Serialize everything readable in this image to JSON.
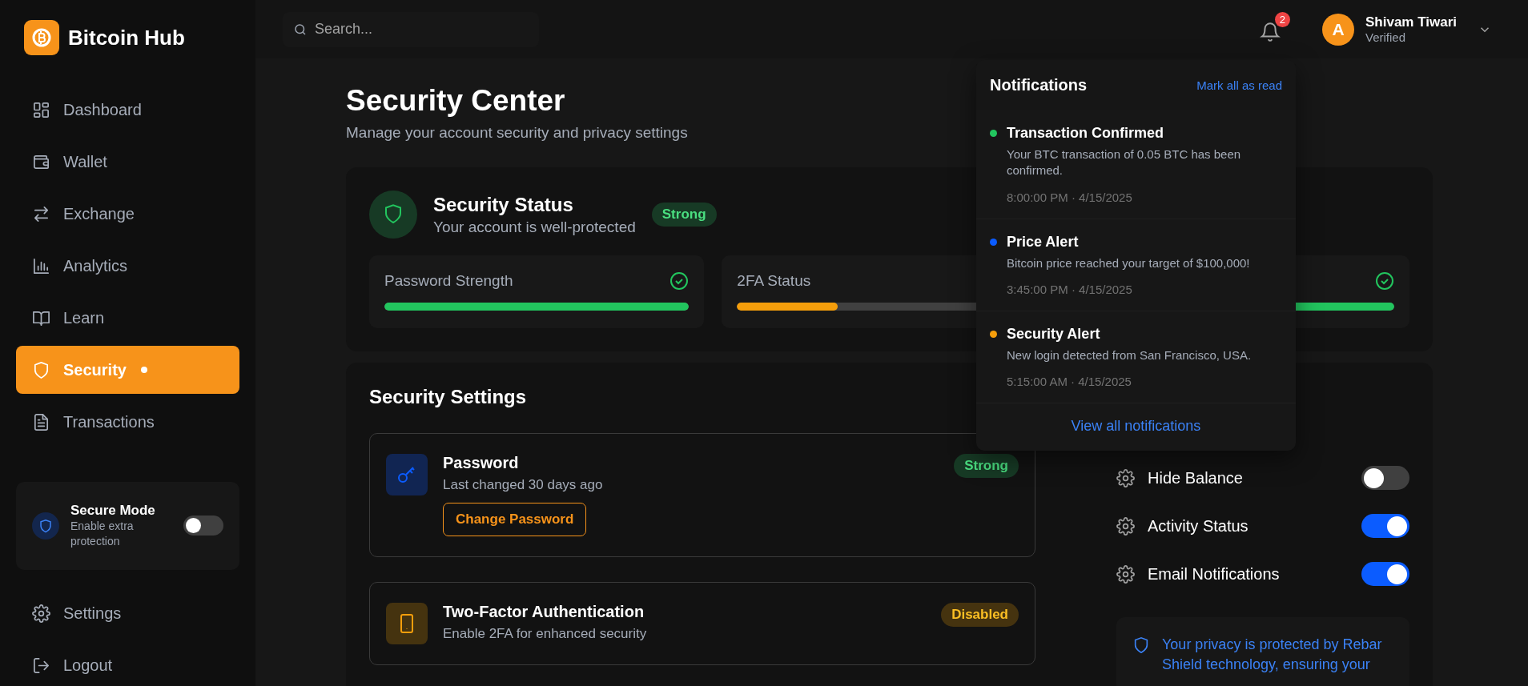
{
  "brand": {
    "name": "Bitcoin Hub"
  },
  "sidebar": {
    "items": [
      {
        "label": "Dashboard",
        "selected": false,
        "dot": false
      },
      {
        "label": "Wallet",
        "selected": false,
        "dot": false
      },
      {
        "label": "Exchange",
        "selected": false,
        "dot": false
      },
      {
        "label": "Analytics",
        "selected": false,
        "dot": false
      },
      {
        "label": "Learn",
        "selected": false,
        "dot": false
      },
      {
        "label": "Security",
        "selected": true,
        "dot": true
      },
      {
        "label": "Transactions",
        "selected": false,
        "dot": false
      }
    ],
    "secure_mode": {
      "title": "Secure Mode",
      "subtitle": "Enable extra protection",
      "on": false
    },
    "footer_items": [
      {
        "label": "Settings"
      },
      {
        "label": "Logout"
      }
    ]
  },
  "topbar": {
    "search": {
      "placeholder": "Search..."
    },
    "notification_count": "2",
    "user": {
      "initial": "A",
      "name": "Shivam Tiwari",
      "status": "Verified"
    }
  },
  "page": {
    "title": "Security Center",
    "subtitle": "Manage your account security and privacy settings"
  },
  "security_status": {
    "title": "Security Status",
    "subtitle": "Your account is well-protected",
    "badge": "Strong",
    "metrics": [
      {
        "label": "Password Strength",
        "level": 1,
        "ok": true,
        "color": "#22c55e"
      },
      {
        "label": "2FA Status",
        "level": 0.33,
        "color": "#f59e0b"
      },
      {
        "level": 1,
        "ok": true,
        "color": "#22c55e"
      }
    ]
  },
  "security_settings": {
    "title": "Security Settings",
    "items": [
      {
        "kind": "password",
        "title": "Password",
        "subtitle": "Last changed 30 days ago",
        "badge": "Strong",
        "button": "Change Password"
      },
      {
        "kind": "twofa",
        "title": "Two-Factor Authentication",
        "subtitle": "Enable 2FA for enhanced security",
        "badge": "Disabled"
      }
    ],
    "toggles": [
      {
        "label": "Hide Balance",
        "on": false
      },
      {
        "label": "Activity Status",
        "on": true
      },
      {
        "label": "Email Notifications",
        "on": true
      }
    ],
    "privacy_note": "Your privacy is protected by Rebar Shield technology, ensuring your"
  },
  "notifications": {
    "title": "Notifications",
    "action": "Mark all as read",
    "items": [
      {
        "title": "Transaction Confirmed",
        "message": "Your BTC transaction of 0.05 BTC has been confirmed.",
        "time": "8:00:00 PM · 4/15/2025",
        "color": "#22c55e"
      },
      {
        "title": "Price Alert",
        "message": "Bitcoin price reached your target of $100,000!",
        "time": "3:45:00 PM · 4/15/2025",
        "color": "#0b5cff"
      },
      {
        "title": "Security Alert",
        "message": "New login detected from San Francisco, USA.",
        "time": "5:15:00 AM · 4/15/2025",
        "color": "#f59e0b"
      }
    ],
    "footer": "View all notifications"
  }
}
